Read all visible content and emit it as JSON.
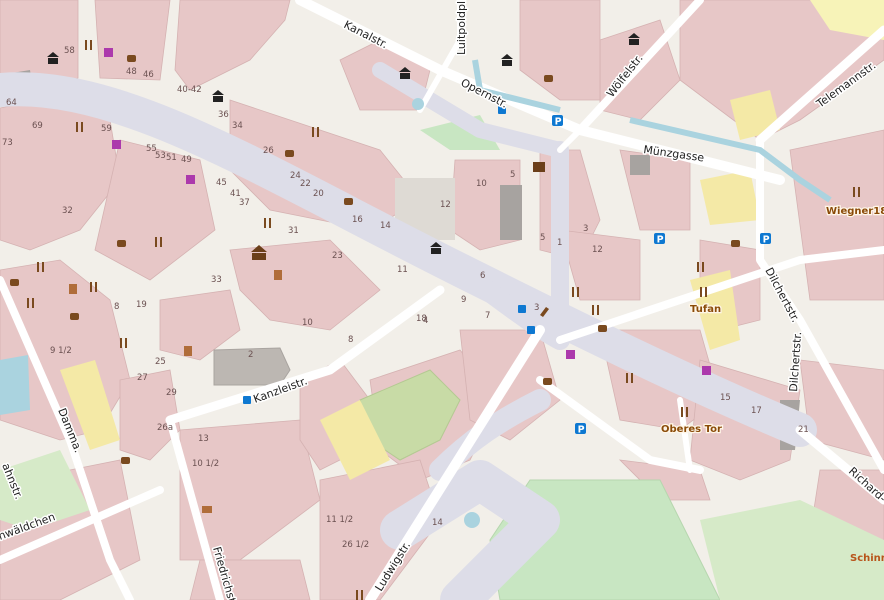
{
  "map": {
    "streets": [
      {
        "id": "kanalstr",
        "name": "Kanalstr."
      },
      {
        "id": "luitpoldpl",
        "name": "Luitpoldpl."
      },
      {
        "id": "opernstr",
        "name": "Opernstr."
      },
      {
        "id": "woelfelstr",
        "name": "Wölfelstr."
      },
      {
        "id": "telemannstr",
        "name": "Telemannstr."
      },
      {
        "id": "muenzgasse",
        "name": "Münzgasse"
      },
      {
        "id": "dilchertstr-1",
        "name": "Dilchertstr."
      },
      {
        "id": "dilchertstr-2",
        "name": "Dilchertstr."
      },
      {
        "id": "kanzleistr",
        "name": "Kanzleistr."
      },
      {
        "id": "dammstr",
        "name": "Damma."
      },
      {
        "id": "friedrichstr",
        "name": "Friedrichst"
      },
      {
        "id": "ludwigstr",
        "name": "Ludwigstr."
      },
      {
        "id": "richardstr",
        "name": "Richard-"
      },
      {
        "id": "ahnstr",
        "name": "ahnstr."
      },
      {
        "id": "waeldchen",
        "name": "nwäldchen"
      }
    ],
    "places": [
      {
        "id": "tufan",
        "name": "Tufan"
      },
      {
        "id": "oberes-tor",
        "name": "Oberes Tor"
      },
      {
        "id": "wiegner",
        "name": "Wiegner187"
      },
      {
        "id": "schinn",
        "name": "Schinn"
      }
    ],
    "house_numbers": [
      "58",
      "48",
      "46",
      "40-42",
      "64",
      "69",
      "59",
      "73",
      "55",
      "53",
      "51",
      "49",
      "45",
      "41",
      "37",
      "36",
      "34",
      "26",
      "24",
      "22",
      "20",
      "16",
      "14",
      "12",
      "10",
      "10",
      "8",
      "6",
      "5",
      "5",
      "4",
      "3",
      "2",
      "1",
      "7",
      "9",
      "11",
      "13",
      "15",
      "17",
      "19",
      "21",
      "23",
      "25",
      "27",
      "29",
      "31",
      "33",
      "9 1/2",
      "10 1/2",
      "11 1/2",
      "26 1/2",
      "26a",
      "32",
      "8",
      "18",
      "3",
      "12",
      "14",
      "2"
    ]
  }
}
